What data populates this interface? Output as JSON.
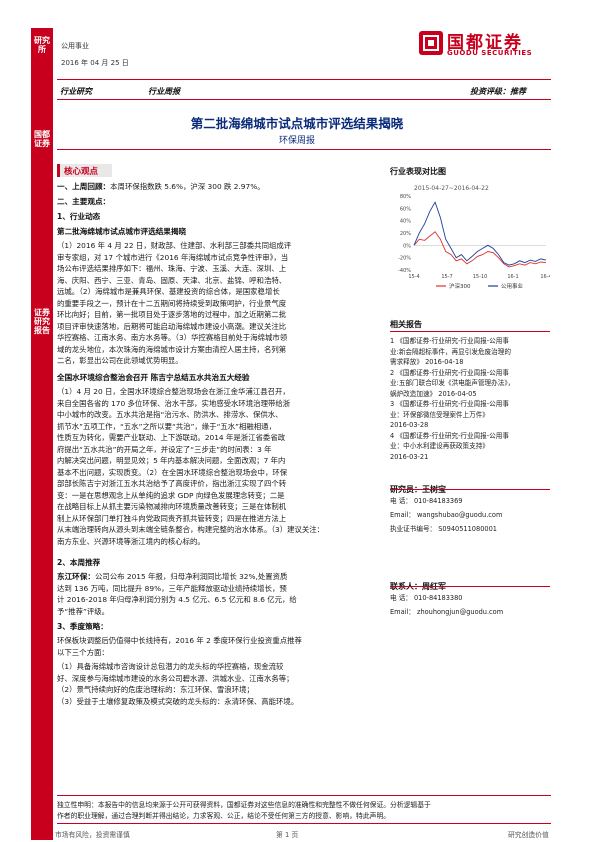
{
  "sidebar": {
    "top_label": "研究所",
    "mid_label": "国都证券",
    "bottom_label": "证券研究报告"
  },
  "header": {
    "industry": "公用事业",
    "date": "2016 年 04 月 25 日",
    "logo_cn": "国都证券",
    "logo_en": "GUODU SECURITIES"
  },
  "tags": {
    "left1": "行业研究",
    "left2": "行业周报",
    "rating": "投资评级：推荐"
  },
  "title": "第二批海绵城市试点城市评选结果揭晓",
  "subtitle": "环保周报",
  "key_points": {
    "label": "核心观点",
    "s1_head": "一、上周回顾：",
    "s1_text": "本周环保指数跌 5.6%，沪深 300 跌 2.97%。",
    "s2_head": "二、主要观点：",
    "s2_1": "1、行业动态",
    "s2_1_title": "第二批海绵城市试点城市评选结果揭晓",
    "p1": [
      "（1）2016 年 4 月 22 日，财政部、住建部、水利部三部委共同组成评",
      "审专家组，对 17 个城市进行《2016 年海绵城市试点竞争性评审》，当",
      "场公布评选结果排序如下：福州、珠海、宁波、玉溪、大连、深圳、上",
      "海、庆阳、西宁、三亚、青岛、固原、天津、北京、盐锦、呼和浩特、",
      "远城。（2）海绵城市是兼具环保、基建投资的综合体，是国家稳增长",
      "的重要手段之一，预计在十二五期间将持续受到政策呵护，行业景气度",
      "环比向好；目前，第一批项目处于逐步落地的过程中，加之近期第二批",
      "项目评审快速落地，后期将可能启动海绵城市建设小高潮。建议关注比",
      "华控赛格、江南水务、南方水务等。（3）华控赛格目前处于海绵城市领",
      "域的龙头地位，本次珠海的海绵城市设计方案由清控人居主持，名列第",
      "二名，彰显出公司在此领域优势明显。"
    ],
    "s2_1b_title": "全国水环境综合整治会召开  陈吉宁总结五水共治五大经验",
    "p2": [
      "（1）4 月 20 日，全国水环境综合整治现场会在浙江金华浦江县召开，",
      "来自全国各省的 170 多位环保、治水干部，实地感受水环境治理带给浙",
      "中小城市的改变。五水共治是指“治污水、防洪水、排涝水、保供水、",
      "抓节水”五项工作，“五水”之所以要“共治”，缘于“五水”相融相通，",
      "性质互为转化，需要产业联动、上下游联动。2014 年是浙江省委省政",
      "府提出“五水共治”的开局之年，并设定了“三步走”的时间表：3 年",
      "内解决突出问题，明显见效；5 年内基本解决问题，全面改观；7 年内",
      "基本不出问题，实现质变。（2）在全国水环境综合整治现场会中，环保",
      "部部长陈吉宁对浙江五水共治给予了高度评价，指出浙江实现了四个转",
      "变：一是在思想观念上从单纯的追求 GDP 向绿色发展理念转变；二是",
      "在战略目标上从抓主要污染物减排向环境质量改善转变；三是在体制机",
      "制上从环保部门单打独斗向党政同责齐抓共管转变；四是在推进方法上",
      "从末端治理转向从源头到末端全链条整合，构建完整的治水体系。（3）建议关注：",
      "南方东业、兴源环境等浙江境内的核心标的。"
    ],
    "s2_2": "2、本周推荐",
    "p3_head": "东江环保：",
    "p3": [
      "公司公布 2015 年报，归母净利润同比增长 32%,处置资质",
      "达到 136 万吨，同比提升 89%，三年产能释放驱动业绩持续增长，预",
      "计 2016-2018 年归母净利润分别为 4.5 亿元、6.5 亿元和 8.6 亿元，给",
      "予“推荐”评级。"
    ],
    "s2_3": "3、季度策略：",
    "p4": [
      "环保板块调整后仍值得中长线持有，2016 年 2 季度环保行业投资重点推荐",
      "以下三个方面："
    ],
    "p4_items": [
      "（1）具备海绵城市咨询设计总包潜力的龙头标的华控赛格，现金流较",
      "好、深度参与海绵城市建设的水务公司碧水源、洪城水业、江南水务等；",
      "（2）景气持续向好的危废治理标的：东江环保、雪浪环境；",
      "（3）受益于土壤修复政策及模式突破的龙头标的：永清环保、高能环境。"
    ]
  },
  "right": {
    "chart_title": "行业表现对比图",
    "related_title": "相关报告",
    "related": [
      "1 《国都证券-行业研究-行业周报-公用事",
      "业:新会隔超标事件，再显引发危废治理的",
      "需求释放》      2016-04-18",
      "2 《国都证券-行业研究-行业周报-公用事",
      "业:五部门联合印发《洪电能声管理办法》，",
      "蜗炉改造加速》      2016-04-05",
      "3 《国都证券-行业研究-行业周报-公用事",
      "业：环保部微信受理案件上万件》",
      "2016-03-28",
      "4 《国都证券-行业研究-行业周报-公用事",
      "业：中小水利建设再获政策支持》",
      "2016-03-21"
    ],
    "analyst1_label": "研究员：",
    "analyst1_name": "王树宝",
    "analyst1_tel": "电    话：  010-84183369",
    "analyst1_email": "Email：  wangshubao@guodu.com",
    "analyst1_cert": "执业证书编号：  S0940511080001",
    "contact_label": "联系人：",
    "contact_name": "周红军",
    "contact_tel": "电    话：  010-84183380",
    "contact_email": "Email：  zhouhongjun@guodu.com"
  },
  "disclaimer": [
    "独立性申明：本报告中的信息均来源于公开可获得资料，国都证券对这些信息的准确性和完整性不做任何保证。分析逻辑基于",
    "作者的职业理解，通过合理判断并得出结论，力求客观、公正，结论不受任何第三方的授意、影响，特此声明。"
  ],
  "footer": {
    "left": "市场有风险，投资需谨慎",
    "center": "第 1 页",
    "right": "研究创造价值"
  },
  "chart_data": {
    "type": "line",
    "title": "2015-04-27~2016-04-22",
    "x_tick_labels": [
      "15-4",
      "15-7",
      "15-10",
      "16-1",
      "16-4"
    ],
    "y_tick_labels": [
      "80%",
      "60%",
      "40%",
      "20%",
      "0%",
      "-20%",
      "-40%"
    ],
    "ylim": [
      -40,
      80
    ],
    "series": [
      {
        "name": "沪深300",
        "color": "#e0302a",
        "x": [
          0,
          0.04,
          0.08,
          0.12,
          0.16,
          0.2,
          0.24,
          0.28,
          0.32,
          0.36,
          0.4,
          0.44,
          0.48,
          0.52,
          0.56,
          0.6,
          0.64,
          0.68,
          0.72,
          0.76,
          0.8,
          0.84,
          0.88,
          0.92,
          0.96,
          1.0
        ],
        "values": [
          0,
          10,
          8,
          15,
          22,
          10,
          -10,
          -15,
          -25,
          -22,
          -30,
          -25,
          -18,
          -15,
          -10,
          -12,
          -20,
          -30,
          -35,
          -33,
          -30,
          -32,
          -28,
          -30,
          -27,
          -28
        ]
      },
      {
        "name": "公用事业",
        "color": "#1f3f9a",
        "x": [
          0,
          0.04,
          0.08,
          0.12,
          0.16,
          0.2,
          0.24,
          0.28,
          0.32,
          0.36,
          0.4,
          0.44,
          0.48,
          0.52,
          0.56,
          0.6,
          0.64,
          0.68,
          0.72,
          0.76,
          0.8,
          0.84,
          0.88,
          0.92,
          0.96,
          1.0
        ],
        "values": [
          0,
          20,
          35,
          55,
          70,
          45,
          10,
          -5,
          -20,
          -15,
          -25,
          -18,
          -10,
          -5,
          0,
          -5,
          -15,
          -28,
          -32,
          -30,
          -25,
          -28,
          -24,
          -26,
          -22,
          -24
        ]
      }
    ],
    "legend": "bottom"
  }
}
